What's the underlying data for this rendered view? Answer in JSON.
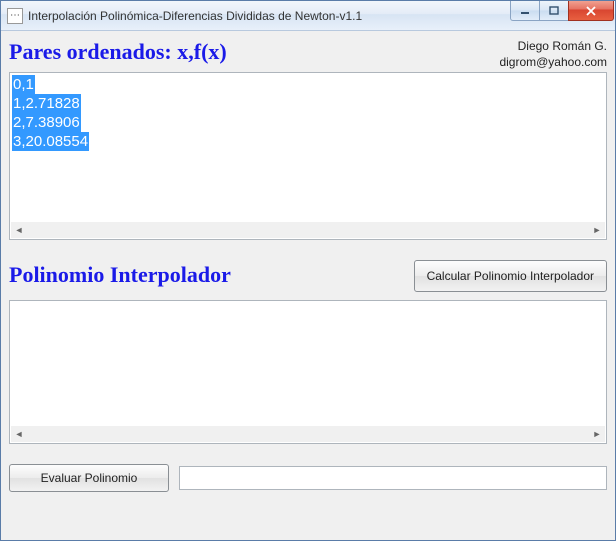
{
  "window": {
    "title": "Interpolación Polinómica-Diferencias Divididas de Newton-v1.1"
  },
  "author": {
    "name": "Diego Román G.",
    "email": "digrom@yahoo.com"
  },
  "pairs": {
    "heading": "Pares ordenados: x,f(x)",
    "lines": [
      "0,1",
      "1,2.71828",
      "2,7.38906",
      "3,20.08554"
    ]
  },
  "poly": {
    "heading": "Polinomio Interpolador",
    "calc_button": "Calcular Polinomio Interpolador",
    "content": ""
  },
  "eval": {
    "button": "Evaluar Polinomio",
    "output": ""
  }
}
